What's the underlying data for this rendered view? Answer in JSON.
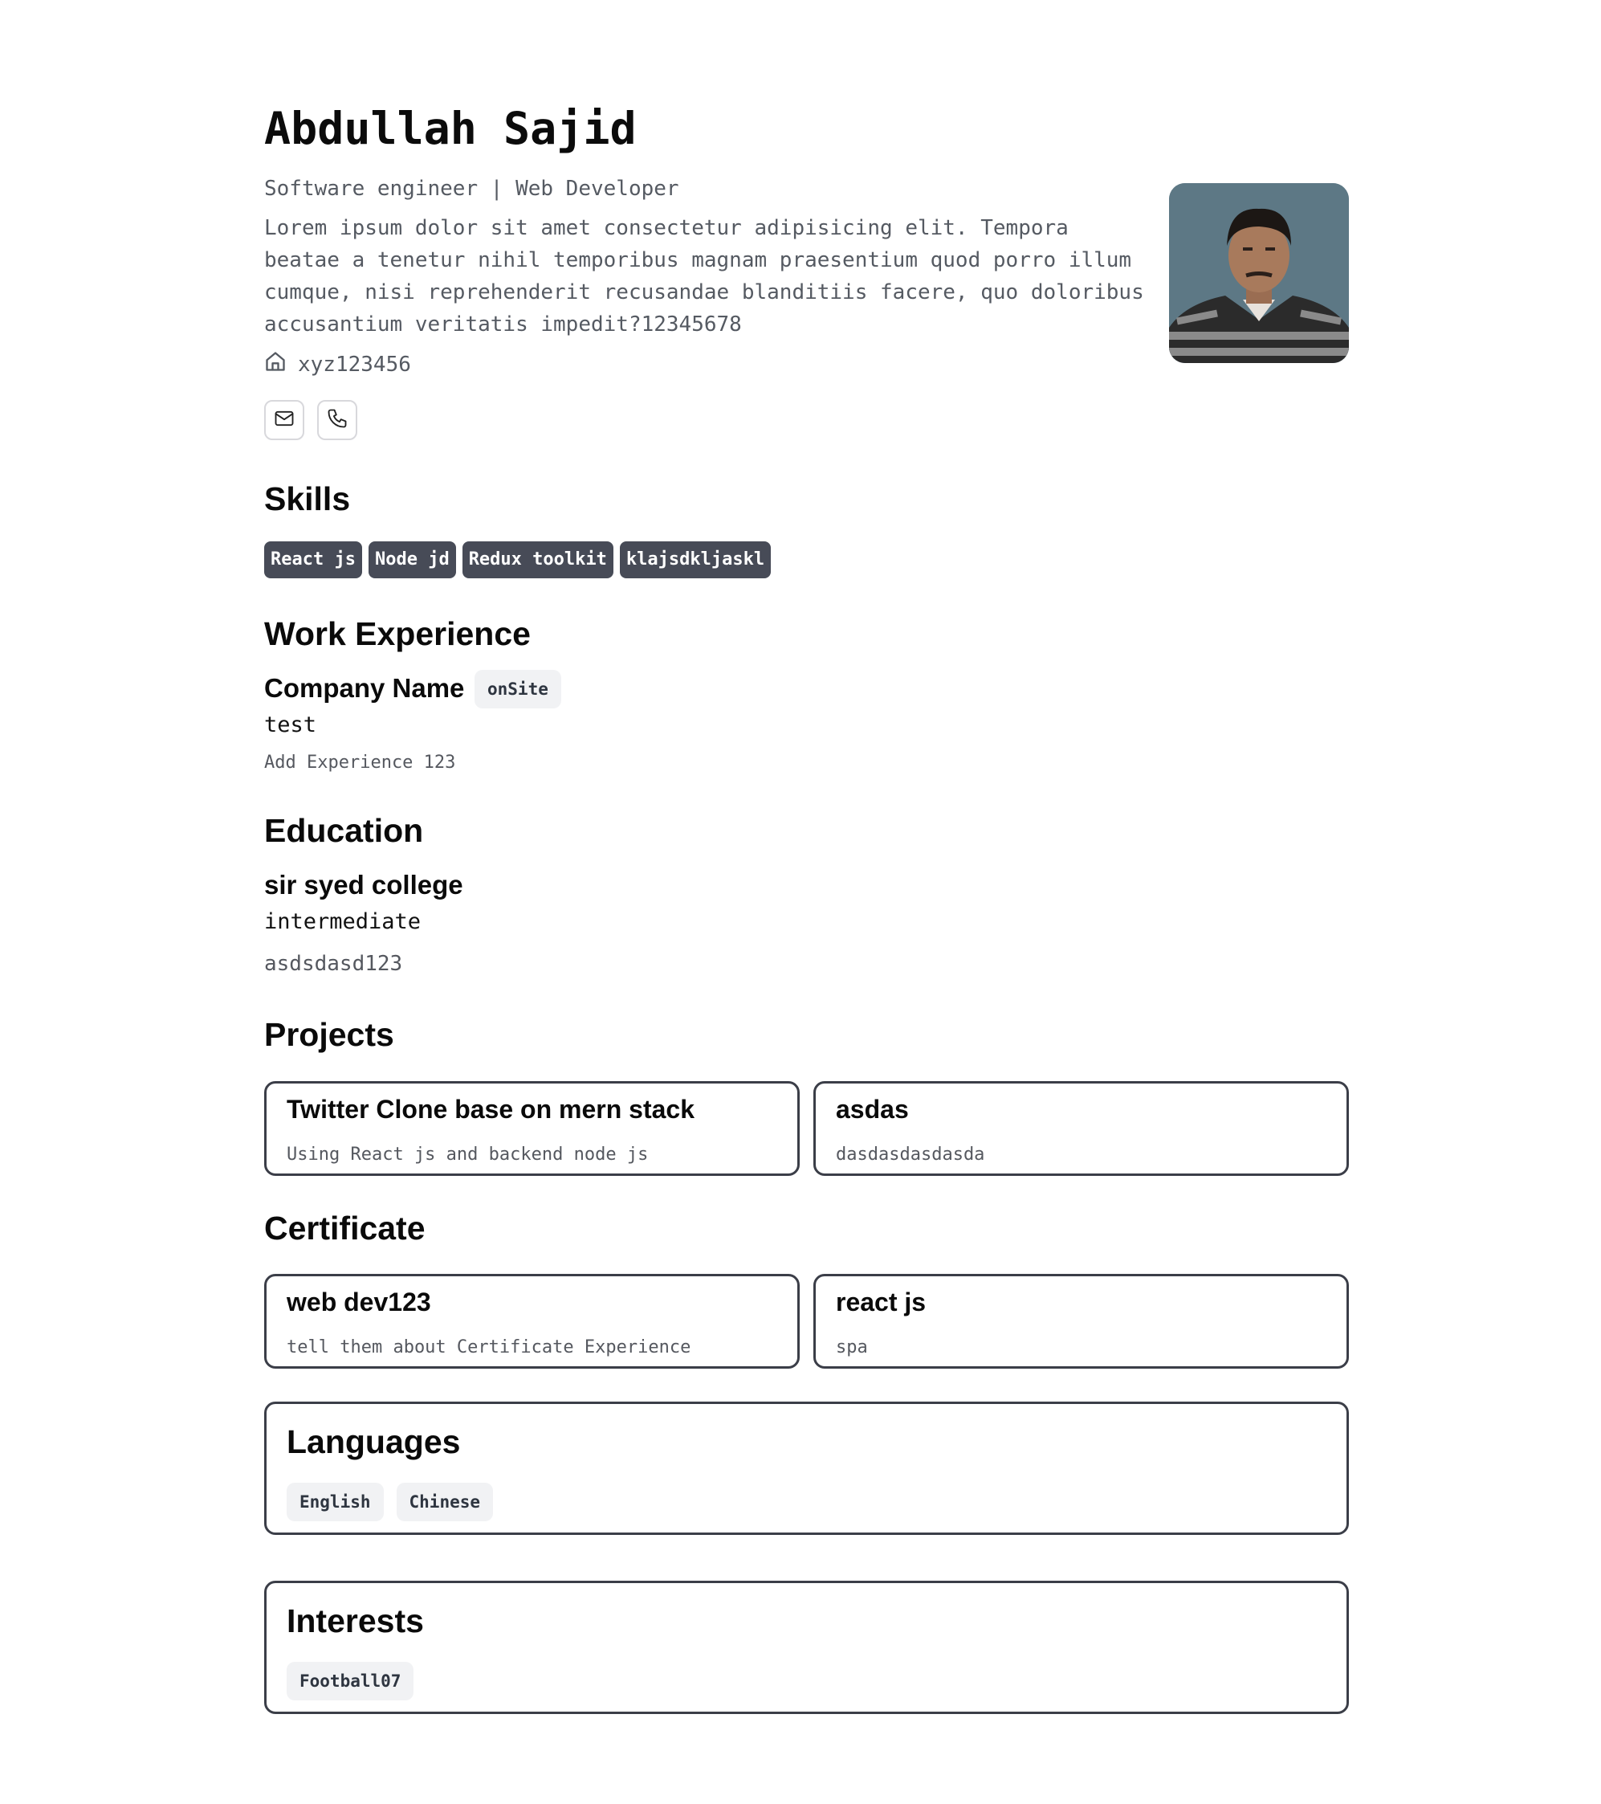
{
  "profile": {
    "name": "Abdullah Sajid",
    "role": "Software engineer | Web Developer",
    "about": "Lorem ipsum dolor sit amet consectetur adipisicing elit. Tempora beatae a tenetur nihil temporibus magnam praesentium quod porro illum cumque, nisi reprehenderit recusandae blanditiis facere, quo doloribus accusantium veritatis impedit?12345678",
    "location": "xyz123456",
    "location_icon": "home-icon",
    "contact_icons": [
      "mail-icon",
      "phone-icon"
    ]
  },
  "skills": {
    "heading": "Skills",
    "items": [
      "React js",
      "Node jd",
      "Redux toolkit",
      "klajsdkljaskl"
    ]
  },
  "work": {
    "heading": "Work Experience",
    "items": [
      {
        "company": "Company Name",
        "type": "onSite",
        "position": "test",
        "description": "Add Experience 123"
      }
    ]
  },
  "education": {
    "heading": "Education",
    "items": [
      {
        "school": "sir syed college",
        "degree": "intermediate",
        "description": "asdsdasd123"
      }
    ]
  },
  "projects": {
    "heading": "Projects",
    "items": [
      {
        "title": "Twitter Clone base on mern stack",
        "description": "Using React js and backend node js"
      },
      {
        "title": "asdas",
        "description": "dasdasdasdasda"
      }
    ]
  },
  "certificates": {
    "heading": "Certificate",
    "items": [
      {
        "title": "web dev123",
        "description": "tell them about Certificate Experience"
      },
      {
        "title": "react js",
        "description": "spa"
      }
    ]
  },
  "languages": {
    "heading": "Languages",
    "items": [
      "English",
      "Chinese"
    ]
  },
  "interests": {
    "heading": "Interests",
    "items": [
      "Football07"
    ]
  },
  "colors": {
    "text": "#0a0a0a",
    "muted": "#555a62",
    "skill_bg": "#474b57",
    "badge_bg": "#f1f2f4",
    "card_border": "#3b3e48"
  }
}
